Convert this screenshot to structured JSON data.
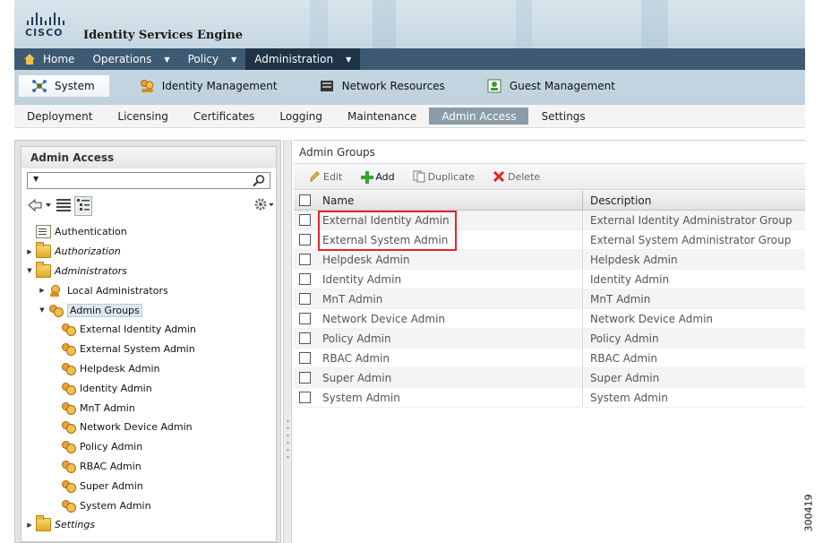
{
  "app": {
    "brand": "CISCO",
    "title": "Identity Services Engine"
  },
  "menubar": [
    {
      "label": "Home",
      "caret": false,
      "active": false
    },
    {
      "label": "Operations",
      "caret": true,
      "active": false
    },
    {
      "label": "Policy",
      "caret": true,
      "active": false
    },
    {
      "label": "Administration",
      "caret": true,
      "active": true
    }
  ],
  "subbar": [
    {
      "label": "System",
      "icon": "system-icon",
      "active": true
    },
    {
      "label": "Identity Management",
      "icon": "identity-icon",
      "active": false
    },
    {
      "label": "Network Resources",
      "icon": "network-icon",
      "active": false
    },
    {
      "label": "Guest Management",
      "icon": "guest-icon",
      "active": false
    }
  ],
  "tabs": [
    "Deployment",
    "Licensing",
    "Certificates",
    "Logging",
    "Maintenance",
    "Admin Access",
    "Settings"
  ],
  "active_tab": "Admin Access",
  "left_panel": {
    "title": "Admin Access",
    "search_value": "",
    "tree": [
      {
        "label": "Authentication",
        "level": 0,
        "toggle": "",
        "icon": "doc",
        "italic": false
      },
      {
        "label": "Authorization",
        "level": 0,
        "toggle": "▶",
        "icon": "folder",
        "italic": true
      },
      {
        "label": "Administrators",
        "level": 0,
        "toggle": "▼",
        "icon": "folder",
        "italic": true
      },
      {
        "label": "Local Administrators",
        "level": 1,
        "toggle": "▶",
        "icon": "user",
        "italic": false
      },
      {
        "label": "Admin Groups",
        "level": 1,
        "toggle": "▼",
        "icon": "users",
        "italic": false,
        "selected": true
      },
      {
        "label": "External Identity Admin",
        "level": 2,
        "toggle": "",
        "icon": "users",
        "italic": false
      },
      {
        "label": "External System Admin",
        "level": 2,
        "toggle": "",
        "icon": "users",
        "italic": false
      },
      {
        "label": "Helpdesk Admin",
        "level": 2,
        "toggle": "",
        "icon": "users",
        "italic": false
      },
      {
        "label": "Identity Admin",
        "level": 2,
        "toggle": "",
        "icon": "users",
        "italic": false
      },
      {
        "label": "MnT Admin",
        "level": 2,
        "toggle": "",
        "icon": "users",
        "italic": false
      },
      {
        "label": "Network Device Admin",
        "level": 2,
        "toggle": "",
        "icon": "users",
        "italic": false
      },
      {
        "label": "Policy Admin",
        "level": 2,
        "toggle": "",
        "icon": "users",
        "italic": false
      },
      {
        "label": "RBAC Admin",
        "level": 2,
        "toggle": "",
        "icon": "users",
        "italic": false
      },
      {
        "label": "Super Admin",
        "level": 2,
        "toggle": "",
        "icon": "users",
        "italic": false
      },
      {
        "label": "System Admin",
        "level": 2,
        "toggle": "",
        "icon": "users",
        "italic": false
      },
      {
        "label": "Settings",
        "level": 0,
        "toggle": "▶",
        "icon": "folder",
        "italic": true
      }
    ]
  },
  "right_panel": {
    "title": "Admin Groups",
    "toolbar": [
      {
        "label": "Edit",
        "icon": "pencil-icon",
        "enabled": false
      },
      {
        "label": "Add",
        "icon": "plus-icon",
        "enabled": true
      },
      {
        "label": "Duplicate",
        "icon": "duplicate-icon",
        "enabled": false
      },
      {
        "label": "Delete",
        "icon": "delete-x-icon",
        "enabled": false
      }
    ],
    "columns": [
      "Name",
      "Description"
    ],
    "rows": [
      {
        "name": "External Identity Admin",
        "description": "External Identity Administrator Group"
      },
      {
        "name": "External System Admin",
        "description": "External System Administrator Group"
      },
      {
        "name": "Helpdesk Admin",
        "description": "Helpdesk Admin"
      },
      {
        "name": "Identity Admin",
        "description": "Identity Admin"
      },
      {
        "name": "MnT Admin",
        "description": "MnT Admin"
      },
      {
        "name": "Network Device Admin",
        "description": "Network Device Admin"
      },
      {
        "name": "Policy Admin",
        "description": "Policy Admin"
      },
      {
        "name": "RBAC Admin",
        "description": "RBAC Admin"
      },
      {
        "name": "Super Admin",
        "description": "Super Admin"
      },
      {
        "name": "System Admin",
        "description": "System Admin"
      }
    ]
  },
  "figure_id": "300419",
  "colors": {
    "menubar": "#3d5a72",
    "menubar_active": "#1f3346",
    "tab_active": "#8a9ca8",
    "highlight": "#e0282a"
  }
}
